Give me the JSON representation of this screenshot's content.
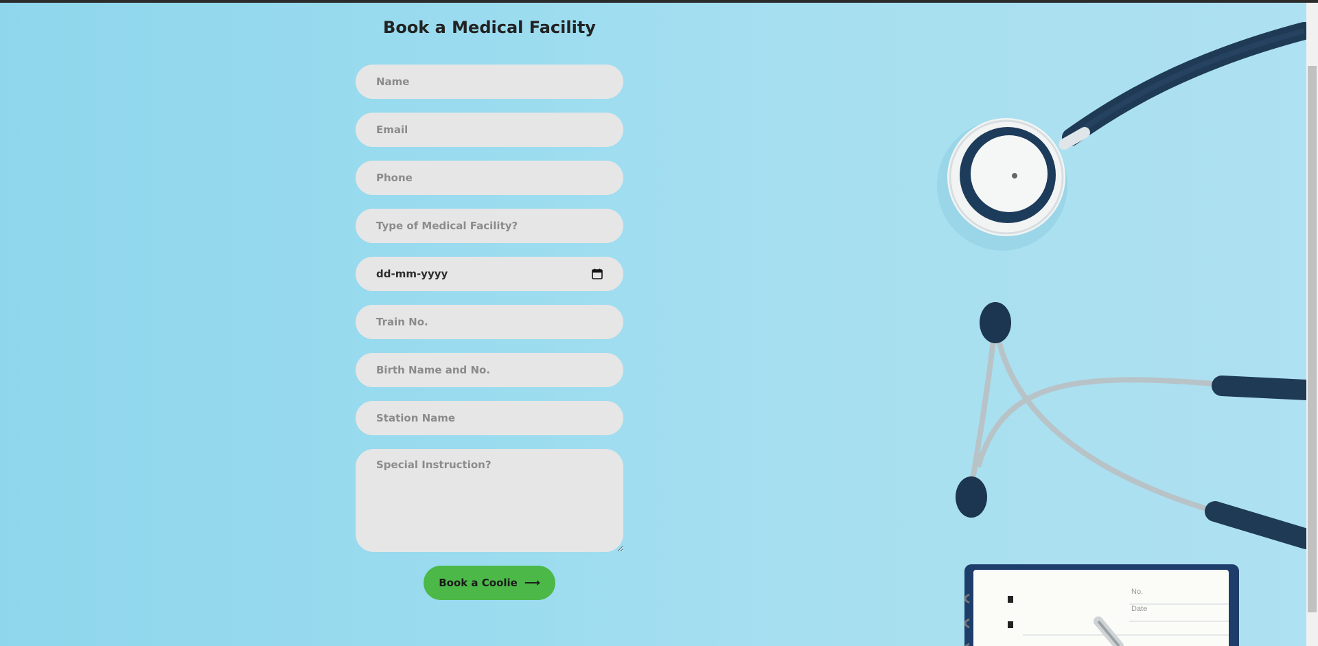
{
  "form": {
    "title": "Book a Medical Facility",
    "fields": {
      "name_placeholder": "Name",
      "email_placeholder": "Email",
      "phone_placeholder": "Phone",
      "facility_type_placeholder": "Type of Medical Facility?",
      "date_value": "dd-mm-yyyy",
      "train_no_placeholder": "Train No.",
      "birth_placeholder": "Birth Name and No.",
      "station_placeholder": "Station Name",
      "instruction_placeholder": "Special Instruction?"
    },
    "submit_label": "Book a Coolie",
    "submit_icon": "arrow-right-icon",
    "date_icon": "calendar-icon"
  },
  "colors": {
    "background": "#9adbef",
    "field_bg": "#e6e6e6",
    "button_bg": "#4cb848",
    "title_text": "#222222"
  },
  "background_image": {
    "icon": "stethoscope-and-notebook-photo",
    "notebook_text": [
      "No.",
      "Date"
    ]
  }
}
